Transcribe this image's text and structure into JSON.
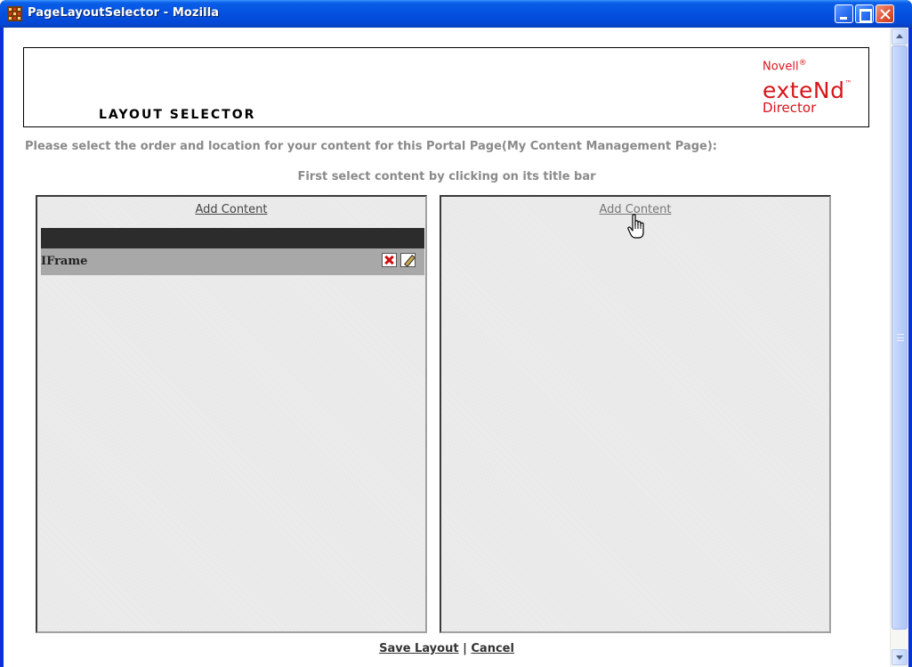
{
  "window": {
    "title": "PageLayoutSelector - Mozilla"
  },
  "banner": {
    "title": "LAYOUT SELECTOR",
    "logo": {
      "novell": "Novell",
      "novell_mark": "®",
      "extend": "exteNd",
      "extend_mark": "™",
      "director": "Director"
    }
  },
  "instructions": {
    "line1": "Please select the order and location for your content for this Portal Page(My Content Management Page):",
    "line2": "First select content by clicking on its title bar"
  },
  "panels": {
    "left": {
      "add_content_label": "Add Content",
      "portlets": [
        {
          "name": "IFrame"
        }
      ]
    },
    "right": {
      "add_content_label": "Add Content"
    }
  },
  "footer": {
    "save_label": "Save Layout",
    "separator": "|",
    "cancel_label": "Cancel"
  },
  "icons": {
    "app": "mozilla-app-icon",
    "minimize": "minimize-icon",
    "maximize": "maximize-icon",
    "close": "close-icon",
    "delete": "delete-x-icon",
    "edit": "pencil-icon",
    "cursor": "hand-pointer-icon"
  },
  "colors": {
    "titlebar": "#0551e0",
    "logo_red": "#d8151b",
    "instruction_text": "#8a8a8a",
    "portlet_bar": "#2c2c2c",
    "portlet_title": "#a8a8a8"
  }
}
